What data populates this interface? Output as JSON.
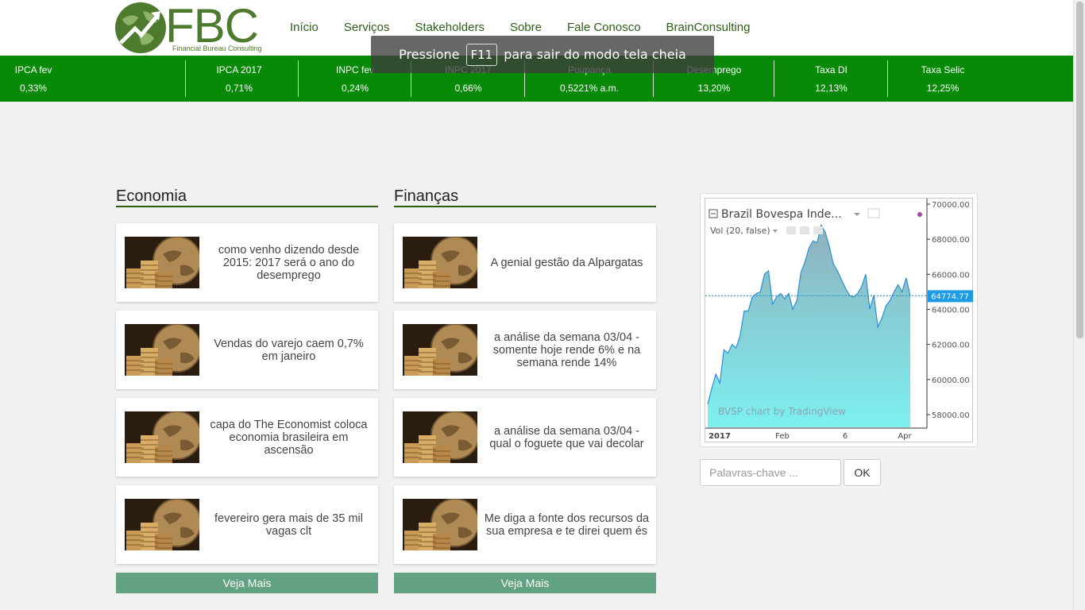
{
  "logo": {
    "text": "FBC",
    "subtitle": "Financial Bureau Consulting"
  },
  "nav": [
    "Início",
    "Serviços",
    "Stakeholders",
    "Sobre",
    "Fale Conosco",
    "BrainConsulting"
  ],
  "indicators": [
    {
      "name": "IPCA fev",
      "value": "0,33%"
    },
    {
      "name": "IPCA 2017",
      "value": "0,71%"
    },
    {
      "name": "INPC fev",
      "value": "0,24%"
    },
    {
      "name": "INPC 2017",
      "value": "0,66%"
    },
    {
      "name": "Poupança",
      "value": "0,5221% a.m."
    },
    {
      "name": "Desemprego",
      "value": "13,20%"
    },
    {
      "name": "Taxa DI",
      "value": "12,13%"
    },
    {
      "name": "Taxa Selic",
      "value": "12,25%"
    }
  ],
  "fullscreen_toast": {
    "before": "Pressione",
    "key": "F11",
    "after": "para sair do modo tela cheia"
  },
  "economia": {
    "title": "Economia",
    "articles": [
      "como venho dizendo desde 2015: 2017 será o ano do desemprego",
      "Vendas do varejo caem 0,7% em janeiro",
      "capa do The Economist coloca economia brasileira em ascensão",
      "fevereiro gera mais de 35 mil vagas clt"
    ],
    "more": "Veja Mais"
  },
  "financas": {
    "title": "Finanças",
    "articles": [
      "A genial gestão da Alpargatas",
      "a análise da semana 03/04 - somente hoje rende 6% e na semana rende 14%",
      "a análise da semana 03/04 - qual o foguete que vai decolar",
      "Me diga a fonte dos recursos da sua empresa e te direi quem és"
    ],
    "more": "Veja Mais"
  },
  "widget": {
    "symbol_title": "Brazil Bovespa Inde...",
    "volume_label": "Vol (20, false)",
    "watermark": "BVSP chart by TradingView",
    "last_price": "64774.77",
    "y_ticks": [
      "70000.00",
      "68000.00",
      "66000.00",
      "64000.00",
      "62000.00",
      "60000.00",
      "58000.00"
    ],
    "x_ticks": [
      "2017",
      "Feb",
      "6",
      "Apr"
    ]
  },
  "chart_data": {
    "type": "area",
    "title": "Brazil Bovespa Inde...",
    "ylim": [
      57000,
      70000
    ],
    "y_ticks": [
      58000,
      60000,
      62000,
      64000,
      66000,
      68000,
      70000
    ],
    "x_ticks": [
      "2017",
      "Feb",
      "6",
      "Apr"
    ],
    "last_value": 64774.77,
    "series": [
      {
        "name": "BVSP",
        "values": [
          58600,
          59500,
          60300,
          59800,
          61700,
          61500,
          62000,
          61800,
          62500,
          63900,
          63900,
          64700,
          64900,
          65000,
          66000,
          66200,
          64300,
          64700,
          64900,
          64600,
          64900,
          64000,
          64500,
          66100,
          66700,
          67500,
          67900,
          67800,
          68800,
          68400,
          67600,
          66600,
          66200,
          65700,
          65200,
          64800,
          64700,
          64900,
          65300,
          66000,
          64000,
          64800,
          63000,
          63500,
          64200,
          64500,
          65000,
          65400,
          65000,
          65800,
          64774.77
        ]
      }
    ],
    "grid": false
  },
  "search": {
    "placeholder": "Palavras-chave ...",
    "button": "OK"
  }
}
